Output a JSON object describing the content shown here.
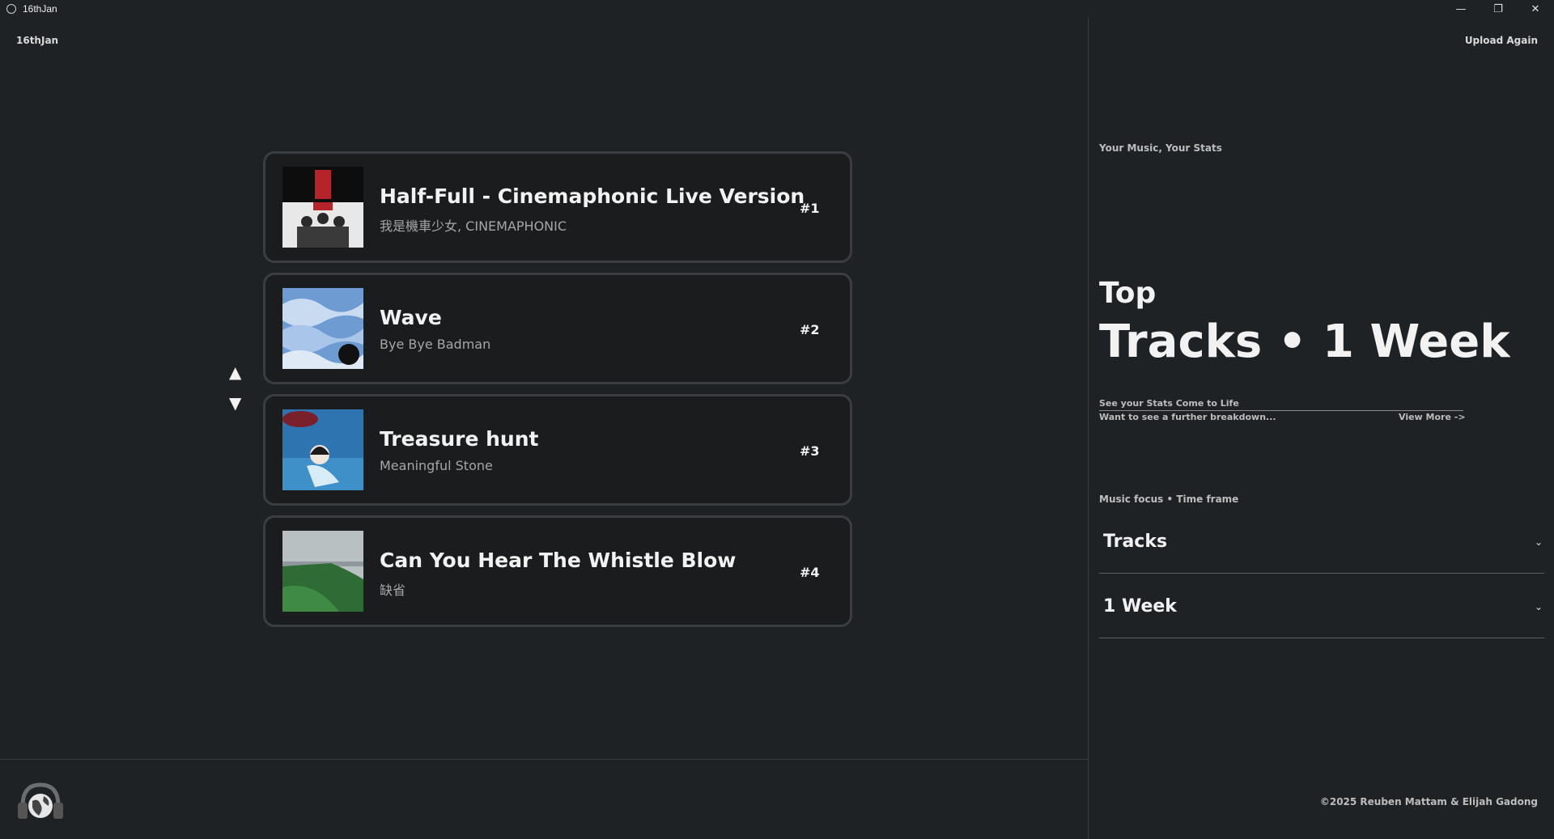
{
  "window": {
    "title": "16thJan",
    "minimize": "—",
    "restore": "❐",
    "close": "✕"
  },
  "header": {
    "brand": "16thJan",
    "upload_label": "Upload Again"
  },
  "tracks": [
    {
      "title": "Half-Full - Cinemaphonic Live Version",
      "artist": "我是機車少女, CINEMAPHONIC",
      "rank": "#1"
    },
    {
      "title": "Wave",
      "artist": "Bye Bye Badman",
      "rank": "#2"
    },
    {
      "title": "Treasure hunt",
      "artist": "Meaningful Stone",
      "rank": "#3"
    },
    {
      "title": "Can You Hear The Whistle Blow",
      "artist": "缺省",
      "rank": "#4"
    }
  ],
  "nav": {
    "up": "▲",
    "down": "▼"
  },
  "panel": {
    "tagline": "Your Music, Your Stats",
    "heading_top": "Top",
    "heading_main": "Tracks • 1 Week",
    "stats_line": "See your Stats Come to Life",
    "breakdown": "Want to see a further breakdown...",
    "view_more": "View More ->",
    "focus_label": "Music focus • Time frame",
    "focus_value": "Tracks",
    "timeframe_value": "1 Week",
    "chevron": "⌄"
  },
  "footer": {
    "copyright": "©2025 Reuben Mattam & Elijah Gadong"
  }
}
